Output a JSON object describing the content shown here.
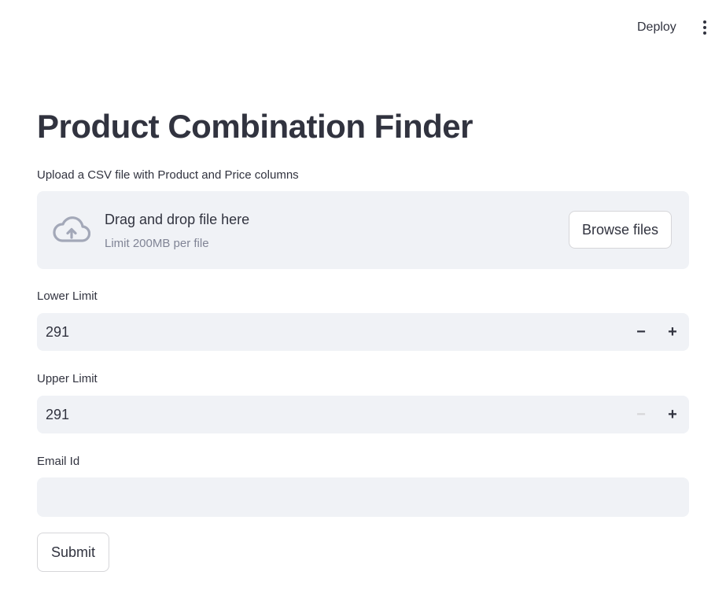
{
  "header": {
    "deploy_label": "Deploy",
    "menu_icon": "vertical-ellipsis-icon"
  },
  "page": {
    "title": "Product Combination Finder"
  },
  "uploader": {
    "label": "Upload a CSV file with Product and Price columns",
    "drop_text": "Drag and drop file here",
    "limit_text": "Limit 200MB per file",
    "browse_label": "Browse files",
    "icon": "cloud-upload-icon"
  },
  "lower_limit": {
    "label": "Lower Limit",
    "value": "291",
    "minus": "−",
    "plus": "+",
    "minus_disabled": false
  },
  "upper_limit": {
    "label": "Upper Limit",
    "value": "291",
    "minus": "−",
    "plus": "+",
    "minus_disabled": true
  },
  "email": {
    "label": "Email Id",
    "value": "",
    "placeholder": ""
  },
  "submit": {
    "label": "Submit"
  },
  "colors": {
    "text": "#31333f",
    "muted": "#808495",
    "input_bg": "#f0f2f6",
    "border": "#d6d6d9",
    "icon": "#a3a8b8"
  }
}
